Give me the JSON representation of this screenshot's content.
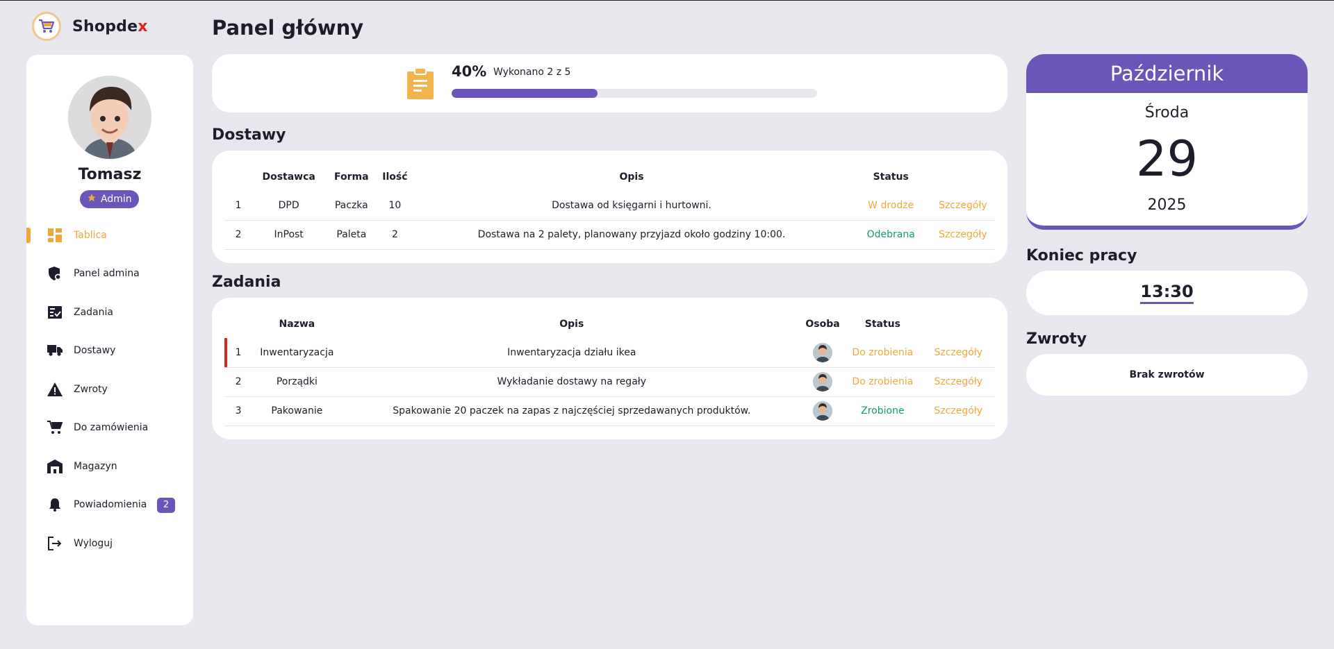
{
  "app": {
    "name_main": "Shopde",
    "name_accent": "x"
  },
  "colors": {
    "accent": "#6c55b8",
    "orange": "#f0a73a",
    "green": "#0f9b76",
    "urgent": "#e2231a"
  },
  "user": {
    "name": "Tomasz",
    "role": "Admin"
  },
  "nav": [
    {
      "label": "Tablica",
      "icon": "dashboard-icon",
      "active": true
    },
    {
      "label": "Panel admina",
      "icon": "admin-shield-icon"
    },
    {
      "label": "Zadania",
      "icon": "tasks-icon"
    },
    {
      "label": "Dostawy",
      "icon": "truck-icon"
    },
    {
      "label": "Zwroty",
      "icon": "warning-icon"
    },
    {
      "label": "Do zamówienia",
      "icon": "cart-icon"
    },
    {
      "label": "Magazyn",
      "icon": "warehouse-icon"
    },
    {
      "label": "Powiadomienia",
      "icon": "bell-icon",
      "badge": "2"
    },
    {
      "label": "Wyloguj",
      "icon": "logout-icon"
    }
  ],
  "page_title": "Panel główny",
  "progress": {
    "percent_label": "40%",
    "text": "Wykonano 2 z 5",
    "fraction": 0.4
  },
  "deliveries": {
    "title": "Dostawy",
    "headers": [
      "",
      "Dostawca",
      "Forma",
      "Ilość",
      "Opis",
      "Status",
      ""
    ],
    "rows": [
      {
        "no": "1",
        "supplier": "DPD",
        "form": "Paczka",
        "qty": "10",
        "desc": "Dostawa od księgarni i hurtowni.",
        "status": "W drodze",
        "status_type": "orange",
        "link": "Szczegóły"
      },
      {
        "no": "2",
        "supplier": "InPost",
        "form": "Paleta",
        "qty": "2",
        "desc": "Dostawa na 2 palety, planowany przyjazd około godziny 10:00.",
        "status": "Odebrana",
        "status_type": "green",
        "link": "Szczegóły"
      }
    ]
  },
  "tasks": {
    "title": "Zadania",
    "headers": [
      "",
      "Nazwa",
      "Opis",
      "Osoba",
      "Status",
      ""
    ],
    "rows": [
      {
        "no": "1",
        "name": "Inwentaryzacja",
        "desc": "Inwentaryzacja działu ikea",
        "status": "Do zrobienia",
        "status_type": "orange",
        "link": "Szczegóły",
        "urgent": true
      },
      {
        "no": "2",
        "name": "Porządki",
        "desc": "Wykładanie dostawy na regały",
        "status": "Do zrobienia",
        "status_type": "orange",
        "link": "Szczegóły"
      },
      {
        "no": "3",
        "name": "Pakowanie",
        "desc": "Spakowanie 20 paczek na zapas z najczęściej sprzedawanych produktów.",
        "status": "Zrobione",
        "status_type": "green",
        "link": "Szczegóły"
      }
    ]
  },
  "calendar": {
    "month": "Październik",
    "weekday": "Środa",
    "day": "29",
    "year": "2025"
  },
  "end_of_work": {
    "title": "Koniec pracy",
    "time": "13:30"
  },
  "returns": {
    "title": "Zwroty",
    "text": "Brak zwrotów"
  }
}
